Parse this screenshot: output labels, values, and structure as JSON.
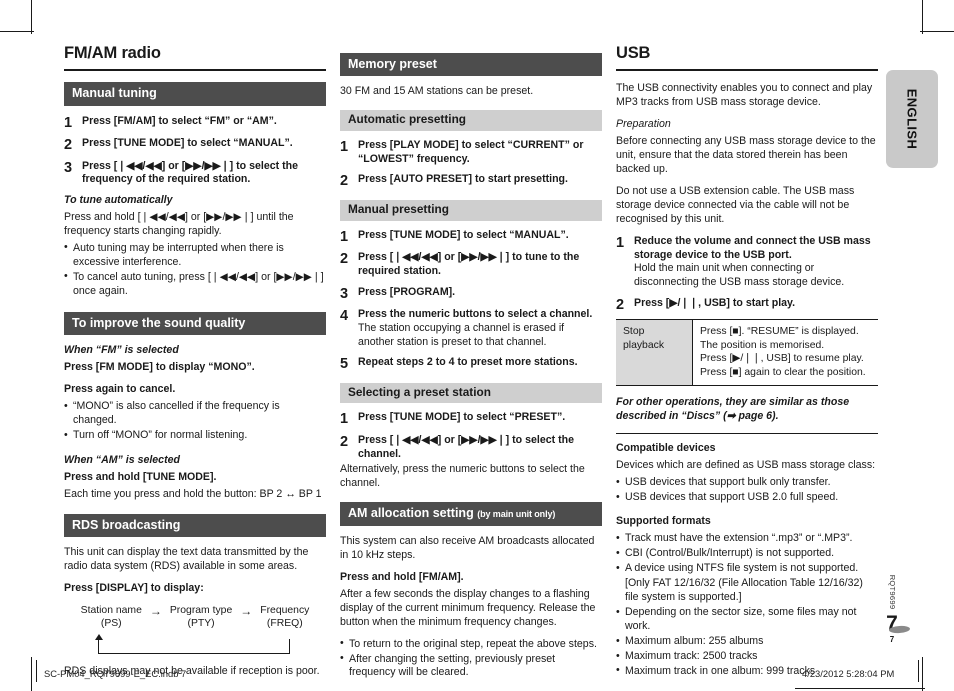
{
  "page": {
    "language_tab": "ENGLISH",
    "page_number": "7",
    "page_number_small": "7",
    "product_code": "RQT9699"
  },
  "footer": {
    "filename": "SC-PM04_RQT9699-E_EC.indb   7",
    "timestamp": "4/23/2012   5:28:04 PM"
  },
  "column1": {
    "chapter_title": "FM/AM radio",
    "manual_tuning": {
      "header": "Manual tuning",
      "steps": [
        {
          "num": "1",
          "main": "Press [FM/AM] to select “FM” or “AM”."
        },
        {
          "num": "2",
          "main": "Press [TUNE MODE] to select “MANUAL”."
        },
        {
          "num": "3",
          "main": "Press [❘◀◀/◀◀] or [▶▶/▶▶❘] to select the frequency of the required station."
        }
      ],
      "auto_heading": "To tune automatically",
      "auto_text": "Press and hold [❘◀◀/◀◀] or [▶▶/▶▶❘] until the frequency starts changing rapidly.",
      "auto_bullets": [
        "Auto tuning may be interrupted when there is excessive interference.",
        "To cancel auto tuning, press [❘◀◀/◀◀] or [▶▶/▶▶❘] once again."
      ]
    },
    "sound_quality": {
      "header": "To improve the sound quality",
      "fm_heading": "When “FM” is selected",
      "fm_line1": "Press [FM MODE] to display “MONO”.",
      "fm_line2": "Press again to cancel.",
      "fm_bullets": [
        "“MONO” is also cancelled if the frequency is changed.",
        "Turn off “MONO” for normal listening."
      ],
      "am_heading": "When “AM” is selected",
      "am_line1": "Press and hold [TUNE MODE].",
      "am_line2": "Each time you press and hold the button: BP 2 ↔ BP 1"
    },
    "rds": {
      "header": "RDS broadcasting",
      "intro": "This unit can display the text data transmitted by the radio data system (RDS) available in some areas.",
      "press_display": "Press [DISPLAY] to display:",
      "diagram": {
        "node1_line1": "Station name",
        "node1_line2": "(PS)",
        "arrow1": "→",
        "node2_line1": "Program type",
        "node2_line2": "(PTY)",
        "arrow2": "→",
        "node3_line1": "Frequency",
        "node3_line2": "(FREQ)"
      },
      "footnote": "RDS displays may not be available if reception is poor."
    }
  },
  "column2": {
    "memory_preset": {
      "header": "Memory preset",
      "intro": "30 FM and 15 AM stations can be preset."
    },
    "automatic_presetting": {
      "header": "Automatic presetting",
      "steps": [
        {
          "num": "1",
          "main": "Press [PLAY MODE] to select “CURRENT” or “LOWEST” frequency."
        },
        {
          "num": "2",
          "main": "Press [AUTO PRESET] to start presetting."
        }
      ]
    },
    "manual_presetting": {
      "header": "Manual presetting",
      "steps": [
        {
          "num": "1",
          "main": "Press [TUNE MODE] to select “MANUAL”.",
          "note": ""
        },
        {
          "num": "2",
          "main": "Press [❘◀◀/◀◀] or [▶▶/▶▶❘] to tune to the required station.",
          "note": ""
        },
        {
          "num": "3",
          "main": "Press [PROGRAM].",
          "note": ""
        },
        {
          "num": "4",
          "main": "Press the numeric buttons to select a channel.",
          "note": "The station occupying a channel is erased if another station is preset to that channel."
        },
        {
          "num": "5",
          "main": "Repeat steps 2 to 4 to preset more stations.",
          "note": ""
        }
      ]
    },
    "selecting_preset": {
      "header": "Selecting a preset station",
      "steps": [
        {
          "num": "1",
          "main": "Press [TUNE MODE] to select “PRESET”."
        },
        {
          "num": "2",
          "main": "Press [❘◀◀/◀◀] or [▶▶/▶▶❘] to select the channel."
        }
      ],
      "alt_text": "Alternatively, press the numeric buttons to select the channel."
    },
    "am_allocation": {
      "header": "AM allocation setting",
      "header_sub": "(by main unit only)",
      "intro": "This system can also receive AM broadcasts allocated in 10 kHz steps.",
      "press_hold": "Press and hold [FM/AM].",
      "body": "After a few seconds the display changes to a flashing display of the current minimum frequency. Release the button when the minimum frequency changes.",
      "bullets": [
        "To return to the original step, repeat the above steps.",
        "After changing the setting, previously preset frequency will be cleared."
      ]
    }
  },
  "column3": {
    "chapter_title": "USB",
    "intro": "The USB connectivity enables you to connect and play MP3 tracks from USB mass storage device.",
    "preparation_heading": "Preparation",
    "preparation_text": "Before connecting any USB mass storage device to the unit, ensure that the data stored therein has been backed up.",
    "extension_note": "Do not use a USB extension cable. The USB mass storage device connected via the cable will not be recognised by this unit.",
    "steps": [
      {
        "num": "1",
        "main": "Reduce the volume and connect the USB mass storage device to the USB port.",
        "note": "Hold the main unit when connecting or disconnecting the USB mass storage device."
      },
      {
        "num": "2",
        "main": "Press [▶/❘❘, USB] to start play.",
        "note": ""
      }
    ],
    "table": {
      "label": "Stop playback",
      "lines": [
        "Press [■]. “RESUME” is displayed.",
        "The position is memorised.",
        "Press [▶/❘❘, USB] to resume play.",
        "Press [■] again to clear the position."
      ]
    },
    "other_ops": "For other operations, they are similar as those described in “Discs” (➡ page 6).",
    "compatible_heading": "Compatible devices",
    "compatible_intro": "Devices which are defined as USB mass storage class:",
    "compatible_bullets": [
      "USB devices that support bulk only transfer.",
      "USB devices that support USB 2.0 full speed."
    ],
    "formats_heading": "Supported formats",
    "formats_bullets": [
      "Track must have the extension “.mp3” or “.MP3”.",
      "CBI (Control/Bulk/Interrupt) is not supported.",
      "A device using NTFS file system is not supported."
    ],
    "formats_cont": "[Only FAT 12/16/32 (File Allocation Table 12/16/32) file system is supported.]",
    "formats_bullets2": [
      "Depending on the sector size, some files may not work.",
      "Maximum album: 255 albums",
      "Maximum track: 2500 tracks",
      "Maximum track in one album: 999 tracks"
    ]
  }
}
